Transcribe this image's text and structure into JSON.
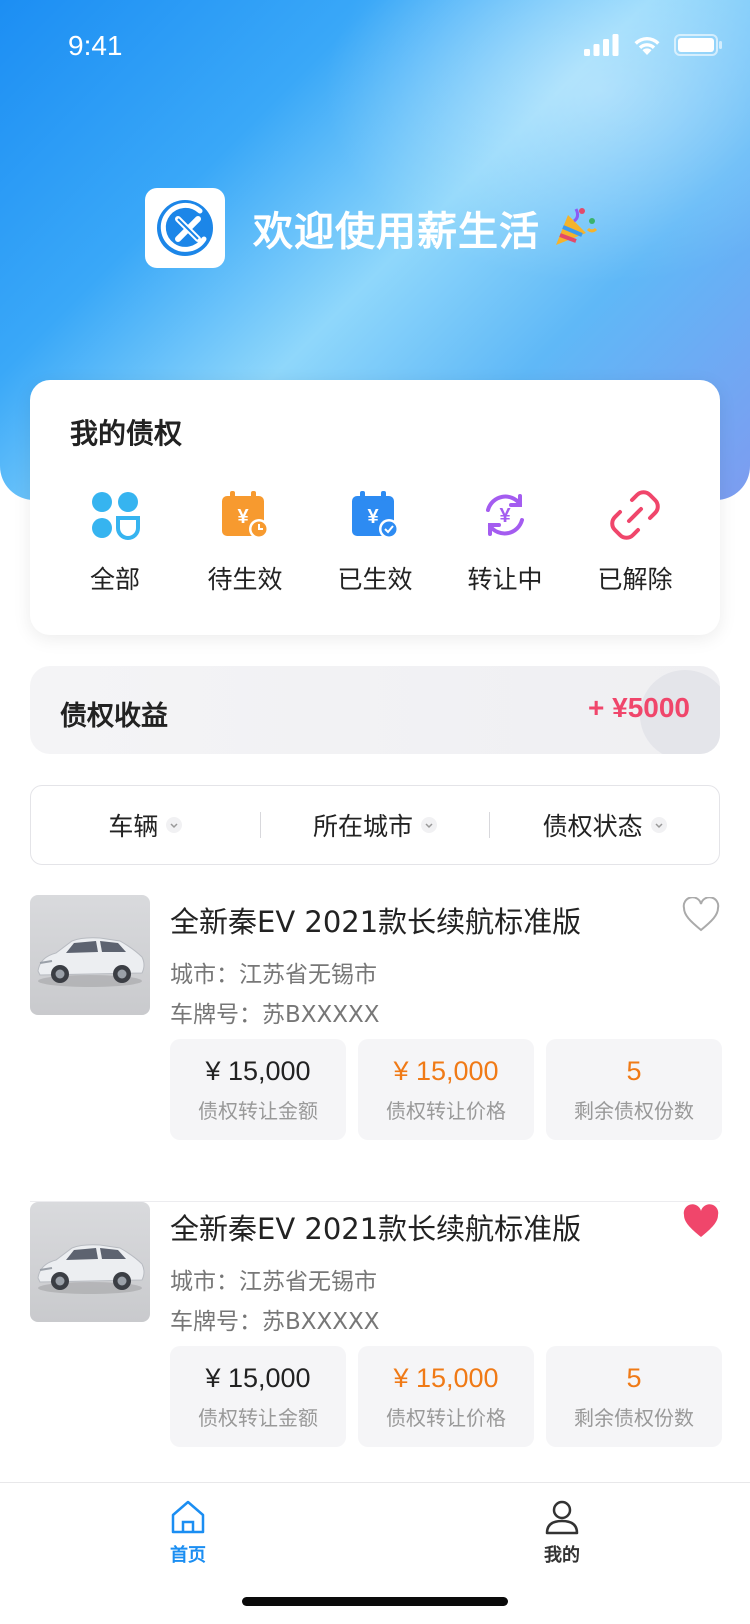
{
  "status_bar": {
    "time": "9:41"
  },
  "header": {
    "welcome": "欢迎使用薪生活",
    "logo_icon": "app-logo-icon",
    "emoji": "party-popper-icon"
  },
  "claims": {
    "title": "我的债权",
    "items": [
      {
        "label": "全部",
        "icon": "grid-all-icon",
        "color": "#36b4f0"
      },
      {
        "label": "待生效",
        "icon": "pending-calendar-icon",
        "color": "#f79a2f"
      },
      {
        "label": "已生效",
        "icon": "effective-calendar-icon",
        "color": "#2d8bf2"
      },
      {
        "label": "转让中",
        "icon": "transfer-cycle-icon",
        "color": "#a45cf0"
      },
      {
        "label": "已解除",
        "icon": "broken-link-icon",
        "color": "#f0466b"
      }
    ]
  },
  "earnings": {
    "title": "债权收益",
    "value": "+ ¥5000",
    "color": "#f0466b"
  },
  "filters": [
    {
      "label": "车辆"
    },
    {
      "label": "所在城市"
    },
    {
      "label": "债权状态"
    }
  ],
  "listings": [
    {
      "title": "全新秦EV 2021款长续航标准版",
      "city": "城市：江苏省无锡市",
      "plate": "车牌号：苏BXXXXX",
      "favorited": false,
      "stats": [
        {
          "value": "¥ 15,000",
          "label": "债权转让金额"
        },
        {
          "value": "¥ 15,000",
          "label": "债权转让价格"
        },
        {
          "value": "5",
          "label": "剩余债权份数"
        }
      ]
    },
    {
      "title": "全新秦EV 2021款长续航标准版",
      "city": "城市：江苏省无锡市",
      "plate": "车牌号：苏BXXXXX",
      "favorited": true,
      "stats": [
        {
          "value": "¥ 15,000",
          "label": "债权转让金额"
        },
        {
          "value": "¥ 15,000",
          "label": "债权转让价格"
        },
        {
          "value": "5",
          "label": "剩余债权份数"
        }
      ]
    }
  ],
  "tabbar": [
    {
      "label": "首页",
      "active": true,
      "icon": "home-icon",
      "color": "#1b8ef2"
    },
    {
      "label": "我的",
      "active": false,
      "icon": "user-icon",
      "color": "#333333"
    }
  ]
}
